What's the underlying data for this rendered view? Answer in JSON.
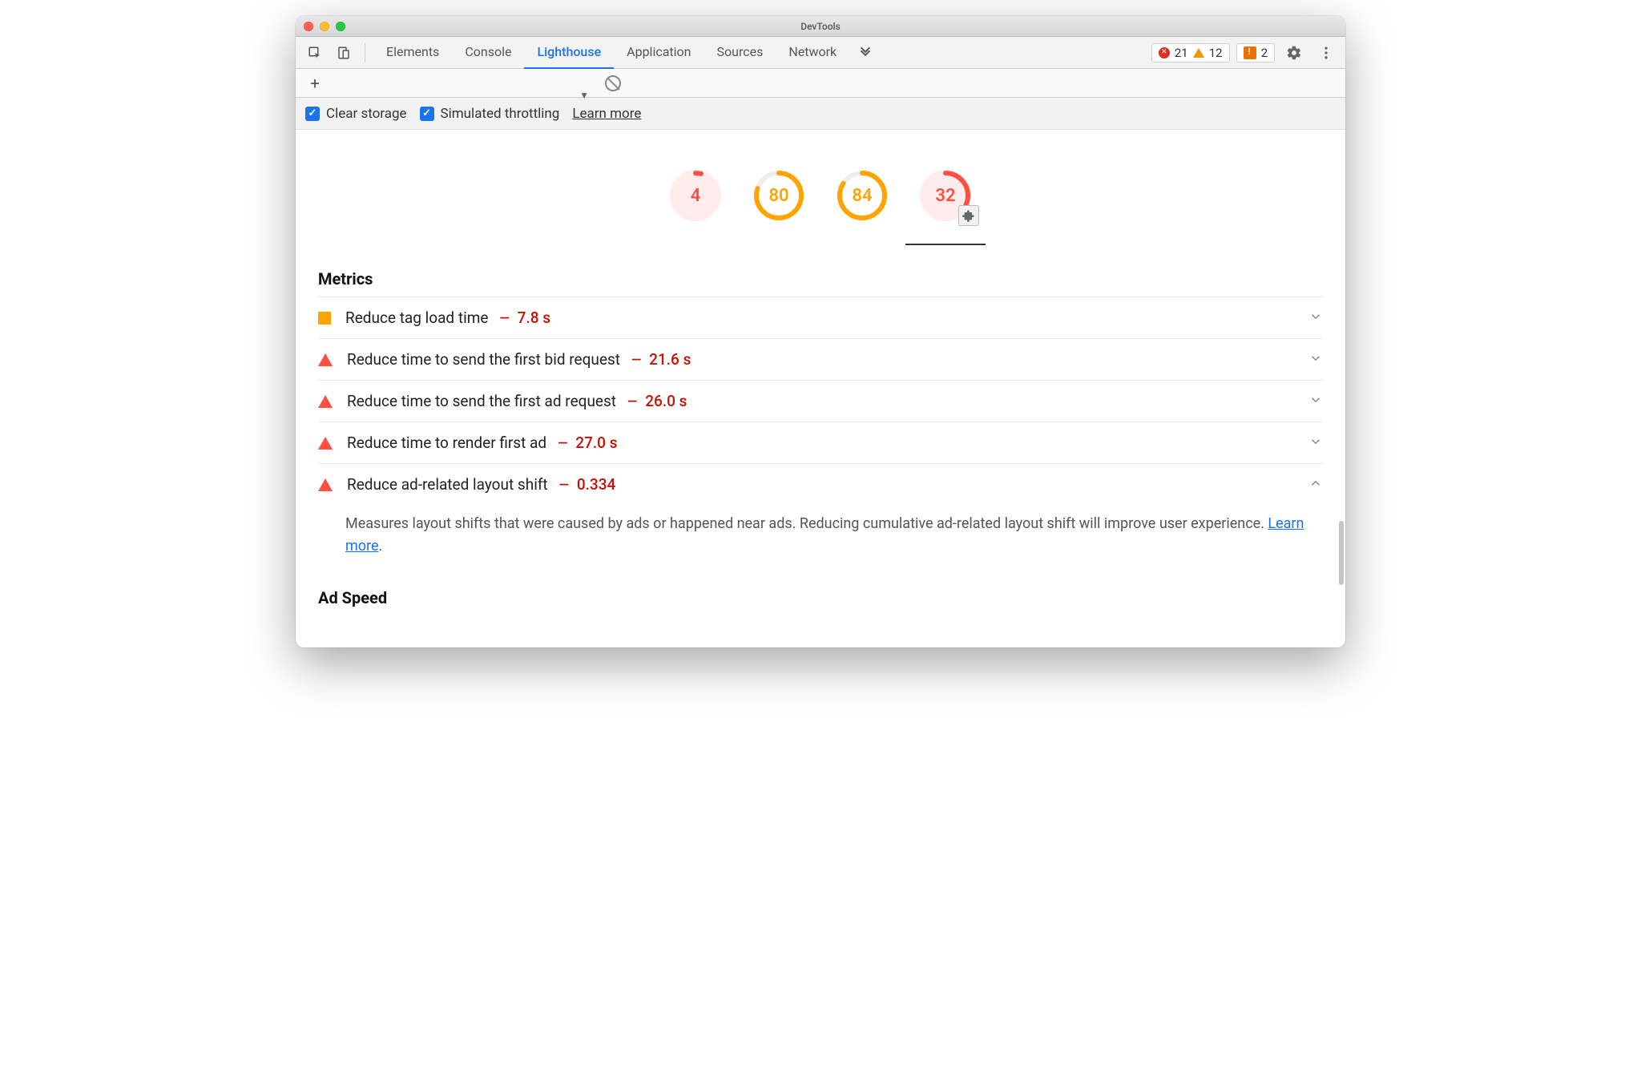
{
  "window": {
    "title": "DevTools"
  },
  "tabs": {
    "items": [
      "Elements",
      "Console",
      "Lighthouse",
      "Application",
      "Sources",
      "Network"
    ],
    "active_index": 2
  },
  "status": {
    "errors": "21",
    "warnings": "12",
    "messages": "2"
  },
  "options": {
    "clear_storage": {
      "label": "Clear storage",
      "checked": true
    },
    "simulated_throttling": {
      "label": "Simulated throttling",
      "checked": true
    },
    "learn_more": "Learn more"
  },
  "scores": [
    {
      "value": "4",
      "color": "red",
      "pct": 4,
      "bg": true
    },
    {
      "value": "80",
      "color": "orange",
      "pct": 80,
      "bg": false
    },
    {
      "value": "84",
      "color": "orange",
      "pct": 84,
      "bg": false
    },
    {
      "value": "32",
      "color": "red",
      "pct": 32,
      "bg": true,
      "plugin": true,
      "active": true
    }
  ],
  "sections": {
    "metrics_title": "Metrics",
    "ad_speed_title": "Ad Speed"
  },
  "metrics": [
    {
      "shape": "square",
      "label": "Reduce tag load time",
      "dash": "—",
      "value": "7.8 s",
      "expanded": false
    },
    {
      "shape": "triangle",
      "label": "Reduce time to send the first bid request",
      "dash": "—",
      "value": "21.6 s",
      "expanded": false
    },
    {
      "shape": "triangle",
      "label": "Reduce time to send the first ad request",
      "dash": "—",
      "value": "26.0 s",
      "expanded": false
    },
    {
      "shape": "triangle",
      "label": "Reduce time to render first ad",
      "dash": "—",
      "value": "27.0 s",
      "expanded": false
    },
    {
      "shape": "triangle",
      "label": "Reduce ad-related layout shift",
      "dash": "—",
      "value": "0.334",
      "expanded": true,
      "desc_a": "Measures layout shifts that were caused by ads or happened near ads. Reducing cumulative ad-related layout shift will improve user experience. ",
      "desc_link": "Learn more",
      "desc_b": "."
    }
  ],
  "colors": {
    "red": "#ff4e42",
    "orange": "#ffa400",
    "blue": "#1a73e8"
  }
}
